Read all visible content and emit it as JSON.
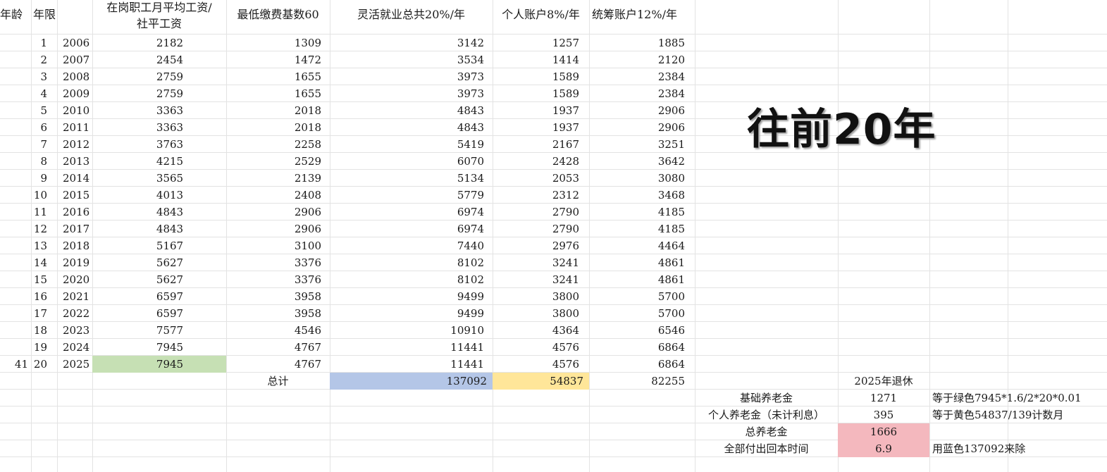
{
  "headers": {
    "age": "年龄",
    "years": "年限",
    "avg_wage_line1": "在岗职工月平均工资/",
    "avg_wage_line2": "社平工资",
    "min_base": "最低缴费基数60",
    "flex_total": "灵活就业总共20%/年",
    "personal": "个人账户8%/年",
    "pooled": "统筹账户12%/年"
  },
  "rows": [
    {
      "n": "1",
      "year": "2006",
      "wage": "2182",
      "base": "1309",
      "flex": "3142",
      "personal": "1257",
      "pooled": "1885"
    },
    {
      "n": "2",
      "year": "2007",
      "wage": "2454",
      "base": "1472",
      "flex": "3534",
      "personal": "1414",
      "pooled": "2120"
    },
    {
      "n": "3",
      "year": "2008",
      "wage": "2759",
      "base": "1655",
      "flex": "3973",
      "personal": "1589",
      "pooled": "2384"
    },
    {
      "n": "4",
      "year": "2009",
      "wage": "2759",
      "base": "1655",
      "flex": "3973",
      "personal": "1589",
      "pooled": "2384"
    },
    {
      "n": "5",
      "year": "2010",
      "wage": "3363",
      "base": "2018",
      "flex": "4843",
      "personal": "1937",
      "pooled": "2906"
    },
    {
      "n": "6",
      "year": "2011",
      "wage": "3363",
      "base": "2018",
      "flex": "4843",
      "personal": "1937",
      "pooled": "2906"
    },
    {
      "n": "7",
      "year": "2012",
      "wage": "3763",
      "base": "2258",
      "flex": "5419",
      "personal": "2167",
      "pooled": "3251"
    },
    {
      "n": "8",
      "year": "2013",
      "wage": "4215",
      "base": "2529",
      "flex": "6070",
      "personal": "2428",
      "pooled": "3642"
    },
    {
      "n": "9",
      "year": "2014",
      "wage": "3565",
      "base": "2139",
      "flex": "5134",
      "personal": "2053",
      "pooled": "3080"
    },
    {
      "n": "10",
      "year": "2015",
      "wage": "4013",
      "base": "2408",
      "flex": "5779",
      "personal": "2312",
      "pooled": "3468"
    },
    {
      "n": "11",
      "year": "2016",
      "wage": "4843",
      "base": "2906",
      "flex": "6974",
      "personal": "2790",
      "pooled": "4185"
    },
    {
      "n": "12",
      "year": "2017",
      "wage": "4843",
      "base": "2906",
      "flex": "6974",
      "personal": "2790",
      "pooled": "4185"
    },
    {
      "n": "13",
      "year": "2018",
      "wage": "5167",
      "base": "3100",
      "flex": "7440",
      "personal": "2976",
      "pooled": "4464"
    },
    {
      "n": "14",
      "year": "2019",
      "wage": "5627",
      "base": "3376",
      "flex": "8102",
      "personal": "3241",
      "pooled": "4861"
    },
    {
      "n": "15",
      "year": "2020",
      "wage": "5627",
      "base": "3376",
      "flex": "8102",
      "personal": "3241",
      "pooled": "4861"
    },
    {
      "n": "16",
      "year": "2021",
      "wage": "6597",
      "base": "3958",
      "flex": "9499",
      "personal": "3800",
      "pooled": "5700"
    },
    {
      "n": "17",
      "year": "2022",
      "wage": "6597",
      "base": "3958",
      "flex": "9499",
      "personal": "3800",
      "pooled": "5700"
    },
    {
      "n": "18",
      "year": "2023",
      "wage": "7577",
      "base": "4546",
      "flex": "10910",
      "personal": "4364",
      "pooled": "6546"
    },
    {
      "n": "19",
      "year": "2024",
      "wage": "7945",
      "base": "4767",
      "flex": "11441",
      "personal": "4576",
      "pooled": "6864"
    },
    {
      "n": "20",
      "year": "2025",
      "wage": "7945",
      "base": "4767",
      "flex": "11441",
      "personal": "4576",
      "pooled": "6864",
      "age": "41"
    }
  ],
  "totals": {
    "label": "总计",
    "flex": "137092",
    "personal": "54837",
    "pooled": "82255"
  },
  "title": "往前20年",
  "summary": {
    "retire_label": "2025年退休",
    "rows": [
      {
        "label": "基础养老金",
        "value": "1271",
        "note": "等于绿色7945*1.6/2*20*0.01"
      },
      {
        "label": "个人养老金（未计利息）",
        "value": "395",
        "note": "等于黄色54837/139计数月"
      },
      {
        "label": "总养老金",
        "value": "1666",
        "note": ""
      },
      {
        "label": "全部付出回本时间",
        "value": "6.9",
        "note": "用蓝色137092来除"
      }
    ]
  },
  "colors": {
    "green": "#c6e0b4",
    "blue": "#b4c6e7",
    "yellow": "#ffe699",
    "pink": "#f4b8be",
    "gridline": "#e3e3e3"
  }
}
